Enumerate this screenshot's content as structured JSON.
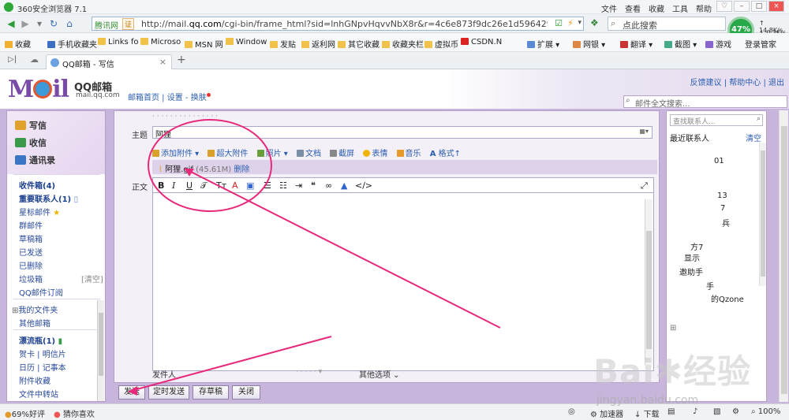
{
  "browser": {
    "title": "360安全浏览器 7.1",
    "menu": [
      "文件",
      "查看",
      "收藏",
      "工具",
      "帮助"
    ],
    "site_name": "腾讯网",
    "cert_label": "证",
    "url_prefix": "http://mail.",
    "url_domain": "qq.com",
    "url_rest": "/cgi-bin/frame_html?sid=lnhGNpvHqvvNbX8r&r=4c6e873f9dc26e1d5964292f1562",
    "search_placeholder": "点此搜索",
    "speed_percent": "47%",
    "speed_up": "14.8K/s",
    "speed_down": "0.3K/s",
    "favorites": [
      "收藏",
      "手机收藏夹",
      "Links fo",
      "Microso",
      "MSN 网",
      "Window",
      "发贴",
      "返利网",
      "其它收藏",
      "收藏夹栏",
      "虚拟币",
      "CSDN.N",
      "扩展",
      "网银",
      "翻译",
      "截图",
      "游戏",
      "登录管家"
    ],
    "tab_title": "QQ邮箱 - 写信"
  },
  "mail": {
    "brand": "QQ邮箱",
    "domain": "mail.qq.com",
    "links": [
      "邮箱首页",
      "设置",
      "换肤"
    ],
    "top_links": [
      "反馈建议",
      "帮助中心",
      "退出"
    ],
    "search_placeholder": "邮件全文搜索...",
    "nav_big": [
      "写信",
      "收信",
      "通讯录"
    ],
    "nav": {
      "inbox": "收件箱(4)",
      "important": "重要联系人(1)",
      "starred": "星标邮件",
      "group": "群邮件",
      "drafts": "草稿箱",
      "sent": "已发送",
      "deleted": "已删除",
      "spam": "垃圾箱",
      "spam_clear": "[清空]",
      "subscribe": "QQ邮件订阅",
      "my_folders": "我的文件夹",
      "other_mailbox": "其他邮箱",
      "bottle": "漂流瓶(1)",
      "card": "贺卡",
      "postcard": "明信片",
      "calendar": "日历",
      "notebook": "记事本",
      "attach_fav": "附件收藏",
      "transfer": "文件中转站"
    },
    "compose": {
      "subject_label": "主题",
      "subject_value": "阿狸",
      "body_label": "正文",
      "toolbar": [
        "添加附件",
        "超大附件",
        "照片",
        "文档",
        "截屏",
        "表情",
        "音乐",
        "格式"
      ],
      "attachment_name": "阿狸.gif",
      "attachment_size": "(45.61M)",
      "attachment_delete": "删除",
      "sender_label": "发件人",
      "more_options": "其他选项"
    },
    "contacts": {
      "search_placeholder": "查找联系人...",
      "recent_label": "最近联系人",
      "clear": "清空",
      "items": [
        "01",
        "13",
        "7",
        "兵",
        "方7",
        "显示",
        "邀助手",
        "手",
        "的Qzone"
      ]
    },
    "buttons": [
      "发送",
      "定时发送",
      "存草稿",
      "关闭"
    ]
  },
  "status": {
    "rating": "69%好评",
    "guess": "猜你喜欢",
    "accelerator": "加速器",
    "download": "下载",
    "zoom": "100%"
  },
  "watermark": {
    "brand": "Bai",
    "brand2": "经验",
    "url": "jingyan.baidu.com"
  },
  "colors": {
    "frame_purple": "#c8b5dc",
    "annotation": "#e8287a",
    "link": "#2a5db0"
  }
}
